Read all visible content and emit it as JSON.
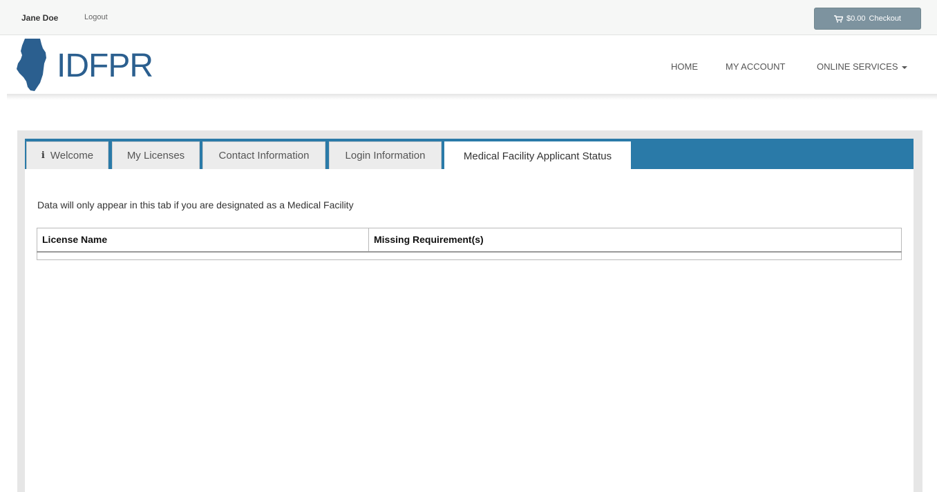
{
  "topbar": {
    "user_name": "Jane Doe",
    "logout_label": "Logout",
    "cart_amount": "$0.00",
    "checkout_label": "Checkout",
    "cart_icon": "cart-icon"
  },
  "header": {
    "logo_text": "IDFPR",
    "logo_icon": "illinois-state-icon",
    "nav": {
      "home": "HOME",
      "account": "MY ACCOUNT",
      "services": "ONLINE SERVICES"
    }
  },
  "tabs": [
    {
      "label": "Welcome",
      "icon": "info-icon",
      "active": false
    },
    {
      "label": "My Licenses",
      "active": false
    },
    {
      "label": "Contact Information",
      "active": false
    },
    {
      "label": "Login Information",
      "active": false
    },
    {
      "label": "Medical Facility Applicant Status",
      "active": true
    }
  ],
  "main": {
    "info_text": "Data will only appear in this tab if you are designated as a Medical Facility",
    "table": {
      "headers": [
        "License Name",
        "Missing Requirement(s)"
      ],
      "rows": []
    }
  },
  "colors": {
    "tab_bar": "#2a7aa8",
    "brand": "#2b5f8f",
    "checkout_button": "#7d939f"
  }
}
